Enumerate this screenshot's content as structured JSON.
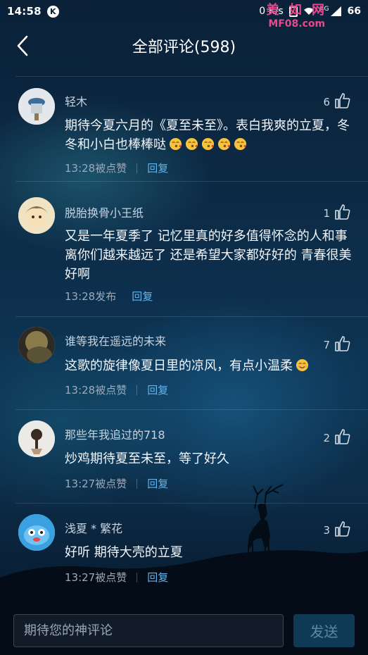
{
  "status_bar": {
    "time": "14:58",
    "k_badge": "K",
    "net_speed": "0 K/s",
    "network": "4G",
    "battery": "66"
  },
  "watermark": {
    "top": "美 如 网",
    "bottom": "MF08.com"
  },
  "header": {
    "title": "全部评论(598)",
    "back_icon": "chevron-left-icon"
  },
  "comments": [
    {
      "user": "轻木",
      "likes": "6",
      "text": "期待今夏六月的《夏至未至》。表白我爽的立夏，冬冬和小白也棒棒哒",
      "emoji_count": 5,
      "time_label": "13:28被点赞",
      "reply_label": "回复"
    },
    {
      "user": "脱胎换骨小王纸",
      "likes": "1",
      "text": "又是一年夏季了 记忆里真的好多值得怀念的人和事 离你们越来越远了 还是希望大家都好好的 青春很美好啊",
      "time_label": "13:28发布",
      "reply_label": "回复"
    },
    {
      "user": "谁等我在遥远的未来",
      "likes": "7",
      "text": "这歌的旋律像夏日里的凉风，有点小温柔",
      "emoji_count": 1,
      "time_label": "13:28被点赞",
      "reply_label": "回复"
    },
    {
      "user": "那些年我追过的718",
      "likes": "2",
      "text": "炒鸡期待夏至未至，等了好久",
      "time_label": "13:27被点赞",
      "reply_label": "回复"
    },
    {
      "user": "浅夏 * 繁花",
      "likes": "3",
      "text": "好听 期待大壳的立夏",
      "time_label": "13:27被点赞",
      "reply_label": "回复"
    }
  ],
  "bottom_bar": {
    "input_placeholder": "期待您的神评论",
    "send_label": "发送"
  },
  "colors": {
    "reply_link": "#62b4ea",
    "send_button_bg": "#0f3a55",
    "watermark": "#e64a8c"
  }
}
